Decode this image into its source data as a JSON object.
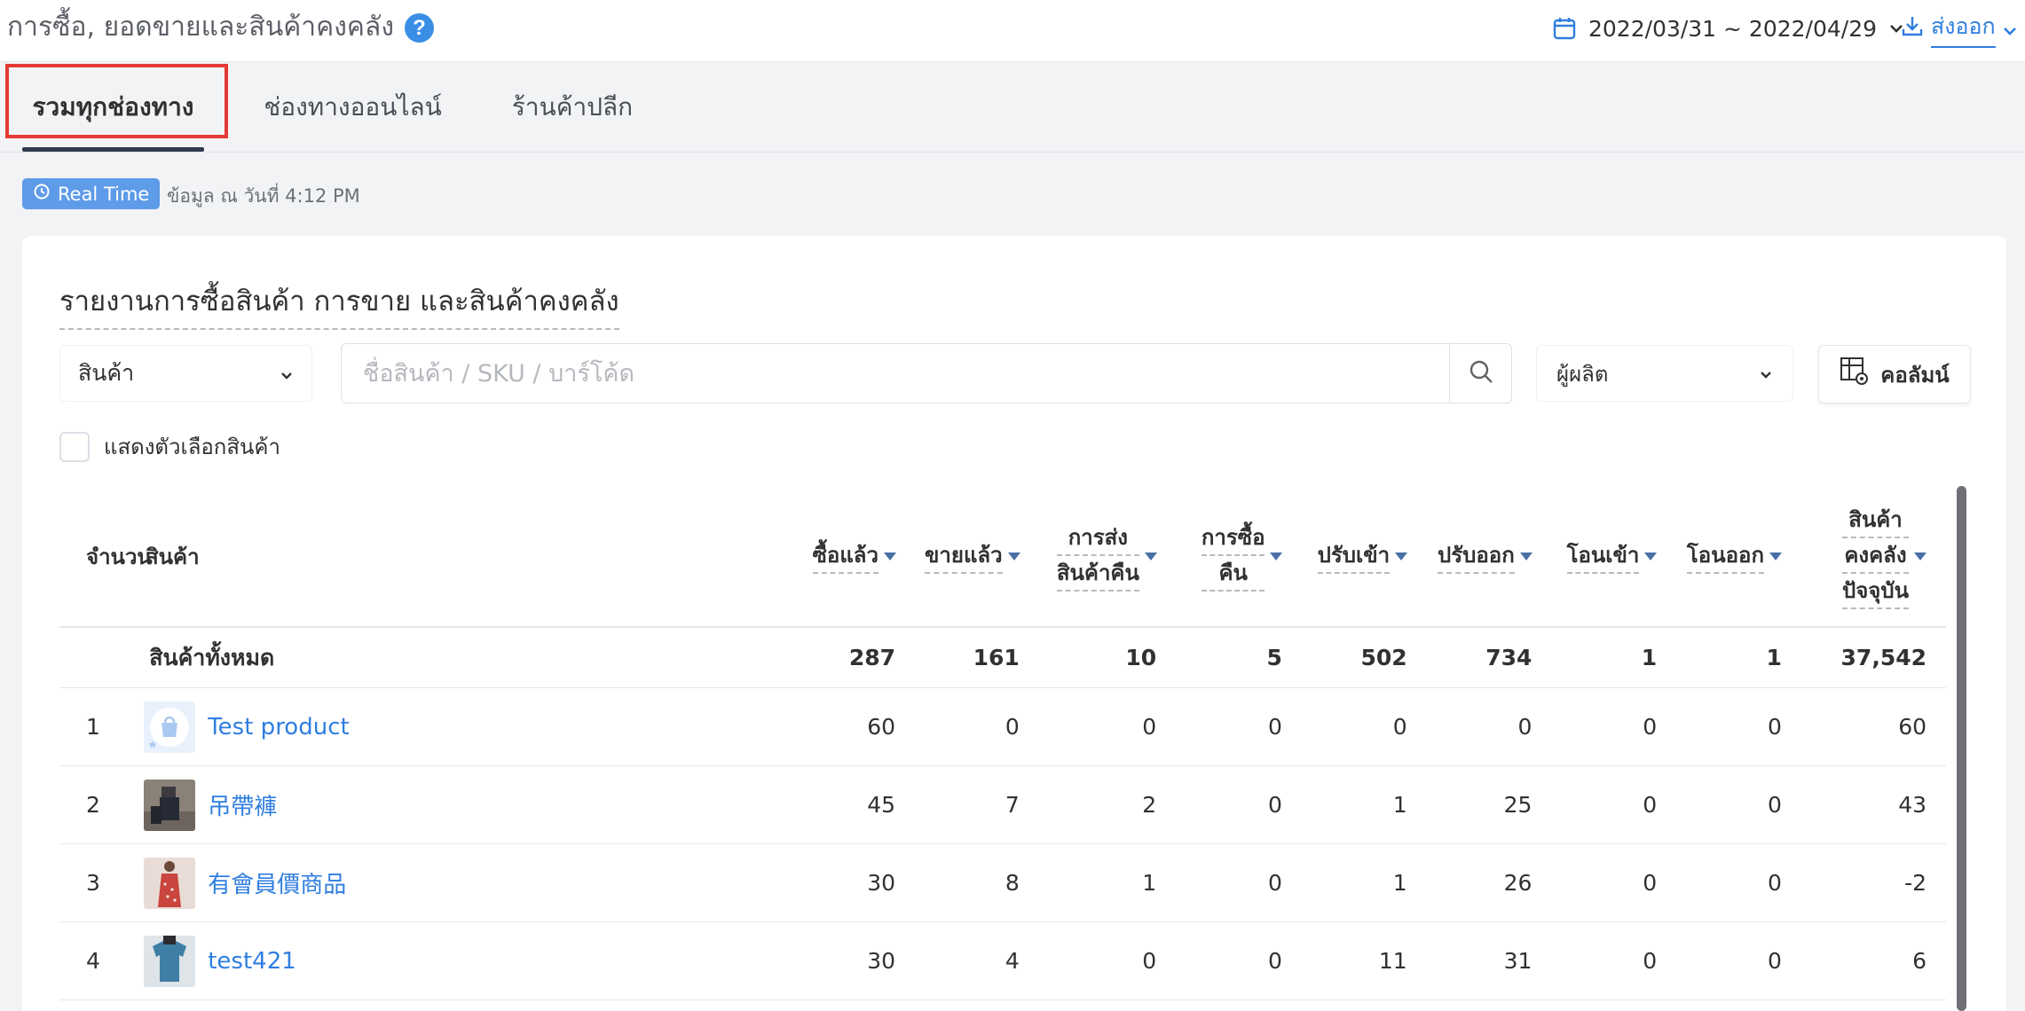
{
  "header": {
    "title": "การซื้อ, ยอดขายและสินค้าคงคลัง",
    "help": "?",
    "date_range": "2022/03/31 ~ 2022/04/29",
    "export_label": "ส่งออก"
  },
  "tabs": [
    {
      "label": "รวมทุกช่องทาง",
      "active": true
    },
    {
      "label": "ช่องทางออนไลน์",
      "active": false
    },
    {
      "label": "ร้านค้าปลีก",
      "active": false
    }
  ],
  "realtime": {
    "badge": "Real Time",
    "text": "ข้อมูล ณ วันที่ 4:12 PM"
  },
  "report": {
    "title": "รายงานการซื้อสินค้า การขาย และสินค้าคงคลัง",
    "filter_select": "สินค้า",
    "search_placeholder": "ชื่อสินค้า / SKU / บาร์โค้ด",
    "search_value": "",
    "maker_select": "ผู้ผลิต",
    "columns_button": "คอลัมน์",
    "show_variants": "แสดงตัวเลือกสินค้า",
    "show_variants_checked": false
  },
  "table": {
    "headers": {
      "index": "จำนวน",
      "product": "สินค้า",
      "bought": [
        "ซื้อแล้ว"
      ],
      "sold": [
        "ขายแล้ว"
      ],
      "returned": [
        "การส่ง",
        "สินค้าคืน"
      ],
      "refund": [
        "การซื้อ",
        "คืน"
      ],
      "adj_in": [
        "ปรับเข้า"
      ],
      "adj_out": [
        "ปรับออก"
      ],
      "transfer_in": [
        "โอนเข้า"
      ],
      "transfer_out": [
        "โอนออก"
      ],
      "stock": [
        "สินค้า",
        "คงคลัง",
        "ปัจจุบัน"
      ]
    },
    "total": {
      "label": "สินค้าทั้งหมด",
      "bought": "287",
      "sold": "161",
      "returned": "10",
      "refund": "5",
      "adj_in": "502",
      "adj_out": "734",
      "transfer_in": "1",
      "transfer_out": "1",
      "stock": "37,542"
    },
    "rows": [
      {
        "index": "1",
        "name": "Test product",
        "bought": "60",
        "sold": "0",
        "returned": "0",
        "refund": "0",
        "adj_in": "0",
        "adj_out": "0",
        "transfer_in": "0",
        "transfer_out": "0",
        "stock": "60"
      },
      {
        "index": "2",
        "name": "吊帶褲",
        "bought": "45",
        "sold": "7",
        "returned": "2",
        "refund": "0",
        "adj_in": "1",
        "adj_out": "25",
        "transfer_in": "0",
        "transfer_out": "0",
        "stock": "43"
      },
      {
        "index": "3",
        "name": "有會員價商品",
        "bought": "30",
        "sold": "8",
        "returned": "1",
        "refund": "0",
        "adj_in": "1",
        "adj_out": "26",
        "transfer_in": "0",
        "transfer_out": "0",
        "stock": "-2"
      },
      {
        "index": "4",
        "name": "test421",
        "bought": "30",
        "sold": "4",
        "returned": "0",
        "refund": "0",
        "adj_in": "11",
        "adj_out": "31",
        "transfer_in": "0",
        "transfer_out": "0",
        "stock": "6"
      }
    ]
  }
}
